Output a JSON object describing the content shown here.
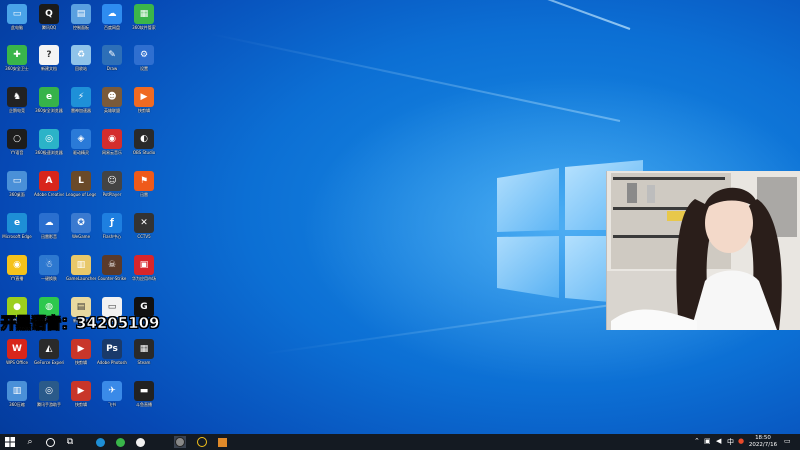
{
  "desktop": {
    "overlay_text": "开黑语音：34205109",
    "icons": [
      {
        "label": "此电脑",
        "color": "#4aa3e8",
        "glyph": "▭"
      },
      {
        "label": "腾讯QQ",
        "color": "#1b1b1b",
        "glyph": "Q"
      },
      {
        "label": "控制面板",
        "color": "#5aa0e0",
        "glyph": "▤"
      },
      {
        "label": "百度网盘",
        "color": "#2e8cf0",
        "glyph": "☁"
      },
      {
        "label": "360软件管家",
        "color": "#3bb54a",
        "glyph": "▦"
      },
      {
        "label": "360安全卫士",
        "color": "#39b54a",
        "glyph": "✚"
      },
      {
        "label": "新建文档",
        "color": "#f4f4f4",
        "glyph": "?"
      },
      {
        "label": "回收站",
        "color": "#8fc3ea",
        "glyph": "♻"
      },
      {
        "label": "Draw",
        "color": "#2d6fb8",
        "glyph": "✎"
      },
      {
        "label": "设置",
        "color": "#2f6fd0",
        "glyph": "⚙"
      },
      {
        "label": "企鹅电竞",
        "color": "#222",
        "glyph": "♞"
      },
      {
        "label": "360安全浏览器",
        "color": "#36b34a",
        "glyph": "e"
      },
      {
        "label": "雷神加速器",
        "color": "#1e90d8",
        "glyph": "⚡"
      },
      {
        "label": "英雄联盟",
        "color": "#7a5a3a",
        "glyph": "☻"
      },
      {
        "label": "快剪辑",
        "color": "#f06a22",
        "glyph": "▶"
      },
      {
        "label": "YY语音",
        "color": "#1d1d1d",
        "glyph": "○"
      },
      {
        "label": "360极速浏览器",
        "color": "#2bb3c8",
        "glyph": "◎"
      },
      {
        "label": "驱动精灵",
        "color": "#2a7ad8",
        "glyph": "◈"
      },
      {
        "label": "网易云音乐",
        "color": "#d42d2d",
        "glyph": "◉"
      },
      {
        "label": "OBS Studio",
        "color": "#2a2a2a",
        "glyph": "◐"
      },
      {
        "label": "360桌面",
        "color": "#4a90d8",
        "glyph": "▭"
      },
      {
        "label": "Adobe Creative",
        "color": "#d8251b",
        "glyph": "A"
      },
      {
        "label": "League of Legends",
        "color": "#6a4a2a",
        "glyph": "L"
      },
      {
        "label": "PotPlayer",
        "color": "#444",
        "glyph": "☺"
      },
      {
        "label": "迅雷",
        "color": "#ef5a1a",
        "glyph": "⚑"
      },
      {
        "label": "Microsoft Edge",
        "color": "#1e8fd6",
        "glyph": "e"
      },
      {
        "label": "迅雷影音",
        "color": "#2a6fcf",
        "glyph": "☁"
      },
      {
        "label": "WeGame",
        "color": "#3a7ad0",
        "glyph": "✪"
      },
      {
        "label": "Flash中心",
        "color": "#1e7fe0",
        "glyph": "ƒ"
      },
      {
        "label": "CCTV5",
        "color": "#333",
        "glyph": "✕"
      },
      {
        "label": "YY直播",
        "color": "#f5c21b",
        "glyph": "◉"
      },
      {
        "label": "一键换肤",
        "color": "#2d78d0",
        "glyph": "☃"
      },
      {
        "label": "GameLauncher",
        "color": "#e8c86a",
        "glyph": "▥"
      },
      {
        "label": "Counter-Strike",
        "color": "#5a3a2a",
        "glyph": "☠"
      },
      {
        "label": "华为应用市场",
        "color": "#d8252b",
        "glyph": "▣"
      },
      {
        "label": "绿色软件",
        "color": "#9ccf1e",
        "glyph": "●"
      },
      {
        "label": "微信",
        "color": "#2dc84d",
        "glyph": "◍"
      },
      {
        "label": "新建文本",
        "color": "#e8d9a0",
        "glyph": "▤"
      },
      {
        "label": "记事本",
        "color": "#f2f2f2",
        "glyph": "▭"
      },
      {
        "label": "罗技",
        "color": "#111",
        "glyph": "G"
      },
      {
        "label": "WPS Office",
        "color": "#d8251b",
        "glyph": "W"
      },
      {
        "label": "GeForce Experience",
        "color": "#2a2a2a",
        "glyph": "◭"
      },
      {
        "label": "快剪辑",
        "color": "#c8362a",
        "glyph": "▶"
      },
      {
        "label": "Adobe Photoshop",
        "color": "#1a3a6a",
        "glyph": "Ps"
      },
      {
        "label": "Steam",
        "color": "#2a2a2a",
        "glyph": "▦"
      },
      {
        "label": "360压缩",
        "color": "#4a90d8",
        "glyph": "▥"
      },
      {
        "label": "腾讯手游助手",
        "color": "#2a5a8a",
        "glyph": "◎"
      },
      {
        "label": "快剪辑",
        "color": "#c8362a",
        "glyph": "▶"
      },
      {
        "label": "飞书",
        "color": "#3a8ae8",
        "glyph": "✈"
      },
      {
        "label": "斗鱼直播",
        "color": "#222",
        "glyph": "▬"
      }
    ]
  },
  "taskbar": {
    "start_label": "Start",
    "search_label": "Search",
    "pinned": [
      "search-icon",
      "cortana-icon",
      "task-view-icon",
      "edge-icon",
      "360-browser-icon",
      "chrome-icon",
      "obs-icon",
      "yy-icon",
      "app-icon"
    ],
    "time": "18:50",
    "date": "2022/7/16"
  }
}
